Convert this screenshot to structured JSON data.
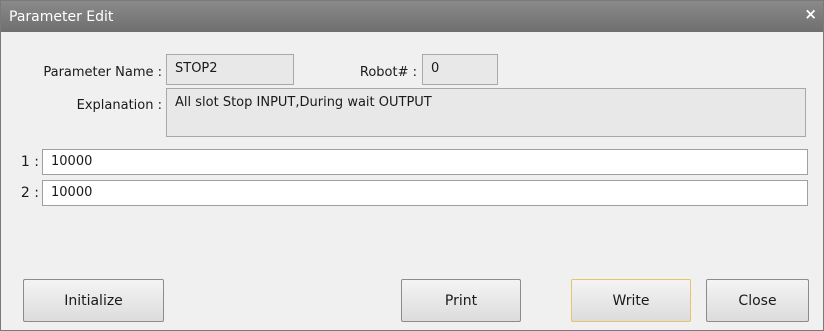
{
  "window": {
    "title": "Parameter Edit",
    "close_glyph": "×"
  },
  "fields": {
    "parameter_name_label": "Parameter Name :",
    "parameter_name_value": "STOP2",
    "robot_label": "Robot# :",
    "robot_value": "0",
    "explanation_label": "Explanation :",
    "explanation_value": "All slot Stop INPUT,During wait OUTPUT"
  },
  "values": [
    {
      "label": "1 :",
      "value": "10000"
    },
    {
      "label": "2 :",
      "value": "10000"
    }
  ],
  "buttons": {
    "initialize": "Initialize",
    "print": "Print",
    "write": "Write",
    "close": "Close"
  }
}
